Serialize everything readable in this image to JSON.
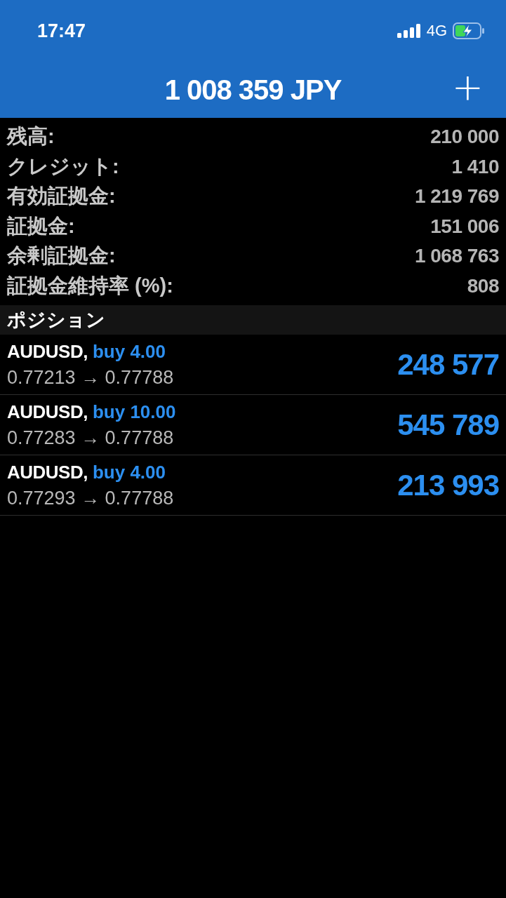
{
  "status_bar": {
    "time": "17:47",
    "network": "4G"
  },
  "header": {
    "title": "1 008 359 JPY",
    "add": "+"
  },
  "summary": [
    {
      "label": "残高:",
      "value": "210 000"
    },
    {
      "label": "クレジット:",
      "value": "1 410"
    },
    {
      "label": "有効証拠金:",
      "value": "1 219 769"
    },
    {
      "label": "証拠金:",
      "value": "151 006"
    },
    {
      "label": "余剰証拠金:",
      "value": "1 068 763"
    },
    {
      "label": "証拠金維持率 (%):",
      "value": "808"
    }
  ],
  "section": "ポジション",
  "positions": [
    {
      "symbol": "AUDUSD,",
      "order": "buy 4.00",
      "prices": "0.77213 → 0.77788",
      "profit": "248 577"
    },
    {
      "symbol": "AUDUSD,",
      "order": "buy 10.00",
      "prices": "0.77283 → 0.77788",
      "profit": "545 789"
    },
    {
      "symbol": "AUDUSD,",
      "order": "buy 4.00",
      "prices": "0.77293 → 0.77788",
      "profit": "213 993"
    }
  ]
}
